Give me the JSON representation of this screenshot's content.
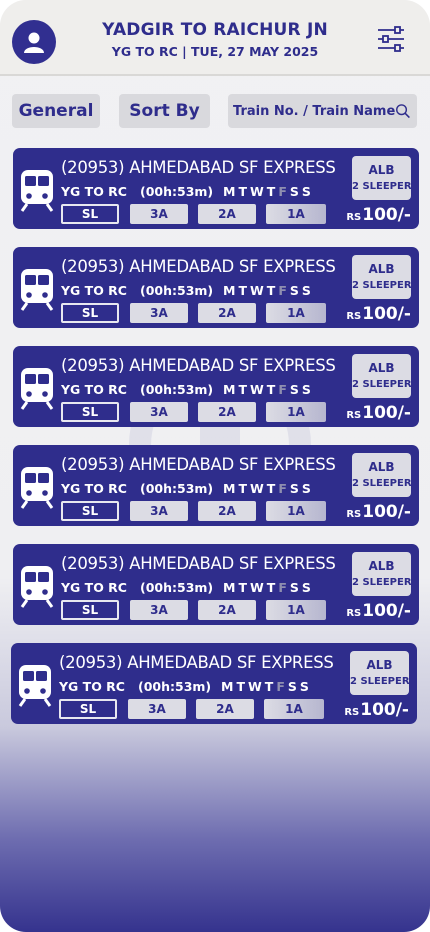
{
  "header": {
    "title": "YADGIR TO RAICHUR JN",
    "subtitle": "YG TO RC | TUE, 27 MAY 2025"
  },
  "controls": {
    "general_label": "General",
    "sort_label": "Sort By",
    "search_placeholder": "Train No. / Train Name"
  },
  "colors": {
    "primary": "#2f2d8c",
    "chip": "#dcdce4",
    "header_bg": "#efeeec"
  },
  "trains": [
    {
      "name": "(20953)  AHMEDABAD SF EXPRESS",
      "route": "YG TO RC",
      "duration": "(00h:53m)",
      "days": [
        "M",
        "T",
        "W",
        "T",
        "F",
        "S",
        "S"
      ],
      "classes": [
        "SL",
        "3A",
        "2A",
        "1A"
      ],
      "availability_line1": "ALB",
      "availability_line2": "2 SLEEPER",
      "currency": "RS",
      "price": "100/-"
    },
    {
      "name": "(20953)  AHMEDABAD SF EXPRESS",
      "route": "YG TO RC",
      "duration": "(00h:53m)",
      "days": [
        "M",
        "T",
        "W",
        "T",
        "F",
        "S",
        "S"
      ],
      "classes": [
        "SL",
        "3A",
        "2A",
        "1A"
      ],
      "availability_line1": "ALB",
      "availability_line2": "2 SLEEPER",
      "currency": "RS",
      "price": "100/-"
    },
    {
      "name": "(20953)  AHMEDABAD SF EXPRESS",
      "route": "YG TO RC",
      "duration": "(00h:53m)",
      "days": [
        "M",
        "T",
        "W",
        "T",
        "F",
        "S",
        "S"
      ],
      "classes": [
        "SL",
        "3A",
        "2A",
        "1A"
      ],
      "availability_line1": "ALB",
      "availability_line2": "2 SLEEPER",
      "currency": "RS",
      "price": "100/-"
    },
    {
      "name": "(20953)  AHMEDABAD SF EXPRESS",
      "route": "YG TO RC",
      "duration": "(00h:53m)",
      "days": [
        "M",
        "T",
        "W",
        "T",
        "F",
        "S",
        "S"
      ],
      "classes": [
        "SL",
        "3A",
        "2A",
        "1A"
      ],
      "availability_line1": "ALB",
      "availability_line2": "2 SLEEPER",
      "currency": "RS",
      "price": "100/-"
    },
    {
      "name": "(20953)  AHMEDABAD SF EXPRESS",
      "route": "YG TO RC",
      "duration": "(00h:53m)",
      "days": [
        "M",
        "T",
        "W",
        "T",
        "F",
        "S",
        "S"
      ],
      "classes": [
        "SL",
        "3A",
        "2A",
        "1A"
      ],
      "availability_line1": "ALB",
      "availability_line2": "2 SLEEPER",
      "currency": "RS",
      "price": "100/-"
    },
    {
      "name": "(20953)  AHMEDABAD SF EXPRESS",
      "route": "YG TO RC",
      "duration": "(00h:53m)",
      "days": [
        "M",
        "T",
        "W",
        "T",
        "F",
        "S",
        "S"
      ],
      "classes": [
        "SL",
        "3A",
        "2A",
        "1A"
      ],
      "availability_line1": "ALB",
      "availability_line2": "2 SLEEPER",
      "currency": "RS",
      "price": "100/-"
    }
  ],
  "icons": {
    "avatar": "user-icon",
    "filter": "filter-sliders-icon",
    "search": "search-icon",
    "train": "train-icon"
  }
}
